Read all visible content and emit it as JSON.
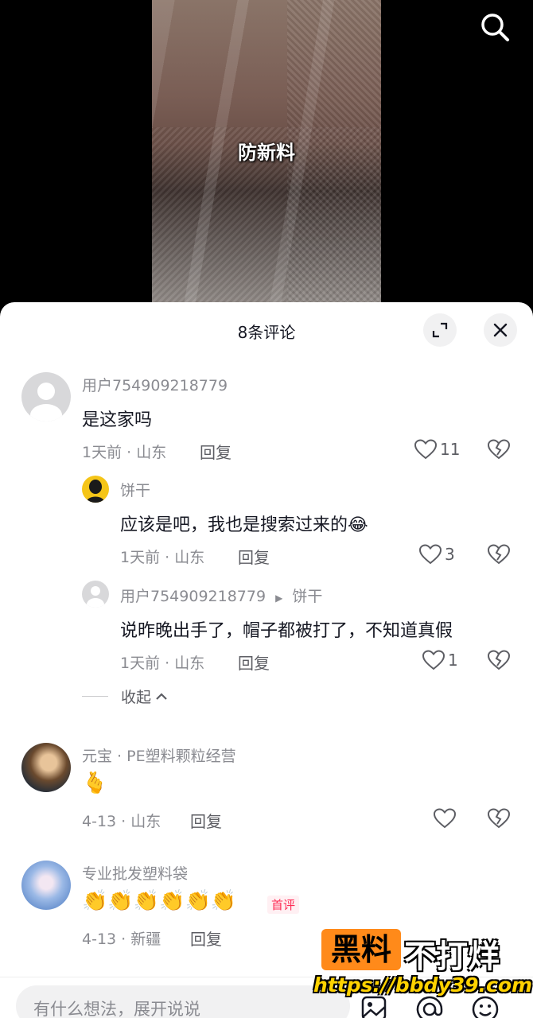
{
  "video": {
    "caption": "防新料"
  },
  "sheet": {
    "title": "8条评论"
  },
  "comments": [
    {
      "user": "用户754909218779",
      "text": "是这家吗",
      "meta": "1天前 · 山东",
      "reply_label": "回复",
      "likes": "11"
    },
    {
      "user": "饼干",
      "text": "应该是吧，我也是搜索过来的😂",
      "meta": "1天前 · 山东",
      "reply_label": "回复",
      "likes": "3"
    },
    {
      "user": "用户754909218779",
      "reply_to": "饼干",
      "text": "说昨晚出手了，帽子都被打了，不知道真假",
      "meta": "1天前 · 山东",
      "reply_label": "回复",
      "likes": "1"
    },
    {
      "user": "元宝 · PE塑料颗粒经营",
      "text": "🫰",
      "meta": "4-13 · 山东",
      "reply_label": "回复",
      "likes": ""
    },
    {
      "user": "专业批发塑料袋",
      "text": "👏👏👏👏👏👏",
      "tag": "首评",
      "meta": "4-13 · 新疆",
      "reply_label": "回复",
      "likes": ""
    }
  ],
  "collapse_label": "收起",
  "input": {
    "placeholder": "有什么想法，展开说说"
  },
  "watermark": {
    "box": "黑料",
    "text": "不打烊",
    "url": "https://bbdy39.com"
  },
  "colors": {
    "accent": "#fe2c55",
    "watermark_orange": "#ff8a1a"
  }
}
